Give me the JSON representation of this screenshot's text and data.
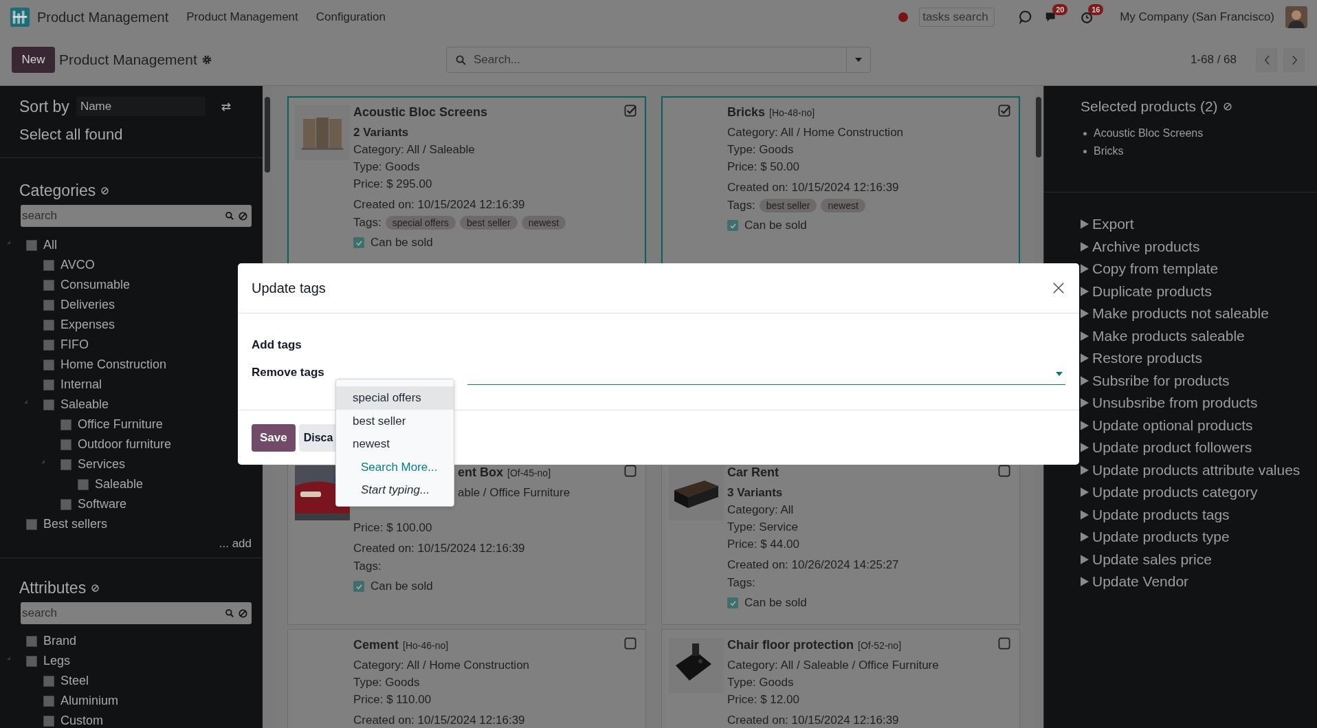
{
  "topbar": {
    "app_name": "Product Management",
    "menu": [
      "Product Management",
      "Configuration"
    ],
    "tasks_search": {
      "placeholder": "tasks search"
    },
    "messages_badge": "20",
    "activities_badge": "16",
    "company": "My Company (San Francisco)"
  },
  "control_panel": {
    "new_button": "New",
    "title": "Product Management",
    "search": {
      "placeholder": "Search..."
    },
    "pager": "1-68 / 68"
  },
  "sidebar": {
    "sort_label": "Sort by",
    "sort_value": "Name",
    "select_all": "Select all found",
    "categories": {
      "title": "Categories",
      "search_placeholder": "search",
      "add": "... add",
      "items": [
        {
          "label": "All",
          "checked": false,
          "children": [
            {
              "label": "AVCO",
              "checked": false
            },
            {
              "label": "Consumable",
              "checked": false
            },
            {
              "label": "Deliveries",
              "checked": false
            },
            {
              "label": "Expenses",
              "checked": false
            },
            {
              "label": "FIFO",
              "checked": false
            },
            {
              "label": "Home Construction",
              "checked": false
            },
            {
              "label": "Internal",
              "checked": false
            },
            {
              "label": "Saleable",
              "checked": false,
              "children": [
                {
                  "label": "Office Furniture",
                  "checked": false
                },
                {
                  "label": "Outdoor furniture",
                  "checked": false
                },
                {
                  "label": "Services",
                  "checked": false,
                  "children": [
                    {
                      "label": "Saleable",
                      "checked": false
                    }
                  ]
                },
                {
                  "label": "Software",
                  "checked": false
                }
              ]
            }
          ]
        },
        {
          "label": "Best sellers",
          "checked": false
        }
      ]
    },
    "attributes": {
      "title": "Attributes",
      "search_placeholder": "search",
      "items": [
        {
          "label": "Brand",
          "checked": false
        },
        {
          "label": "Legs",
          "checked": false,
          "children": [
            {
              "label": "Steel",
              "checked": false
            },
            {
              "label": "Aluminium",
              "checked": false
            },
            {
              "label": "Custom",
              "checked": false
            }
          ]
        }
      ]
    }
  },
  "cards": [
    {
      "name": "Acoustic Bloc Screens",
      "has_image": true,
      "variants": "2 Variants",
      "selected": true,
      "lines": [
        "Category: All / Saleable",
        "Type: Goods",
        "Price: $ 295.00"
      ],
      "created": "Created on: 10/15/2024 12:16:39",
      "tags_label": "Tags:",
      "tags": [
        "special offers",
        "best seller",
        "newest"
      ],
      "sold": {
        "label": "Can be sold",
        "checked": true
      }
    },
    {
      "name": "Bricks",
      "code": "[Ho-48-no]",
      "has_image": false,
      "selected": true,
      "lines": [
        "Category: All / Home Construction",
        "Type: Goods",
        "Price: $ 50.00"
      ],
      "created": "Created on: 10/15/2024 12:16:39",
      "tags_label": "Tags:",
      "tags": [
        "best seller",
        "newest"
      ],
      "sold": {
        "label": "Can be sold",
        "checked": true
      }
    },
    {
      "name": "ent Box",
      "code": "[Of-45-no]",
      "has_image": true,
      "covered": true,
      "selected": false,
      "covered_lines": [
        "able / Office Furniture"
      ],
      "lines": [
        "Price: $ 100.00"
      ],
      "created": "Created on: 10/15/2024 12:16:39",
      "tags_label": "Tags:",
      "sold": {
        "label": "Can be sold",
        "checked": true
      }
    },
    {
      "name": "Car Rent",
      "has_image": true,
      "variants": "3 Variants",
      "selected": false,
      "lines": [
        "Category: All",
        "Type: Service",
        "Price: $ 44.00"
      ],
      "created": "Created on: 10/26/2024 14:25:27",
      "tags_label": "Tags:",
      "sold": {
        "label": "Can be sold",
        "checked": true
      }
    },
    {
      "name": "Cement",
      "code": "[Ho-46-no]",
      "has_image": false,
      "selected": false,
      "lines": [
        "Category: All / Home Construction",
        "Type: Goods",
        "Price: $ 110.00"
      ],
      "created": "Created on: 10/15/2024 12:16:39"
    },
    {
      "name": "Chair floor protection",
      "code": "[Of-52-no]",
      "has_image": true,
      "selected": false,
      "lines": [
        "Category: All / Saleable / Office Furniture",
        "Type: Goods",
        "Price: $ 12.00"
      ],
      "created": "Created on: 10/15/2024 12:16:39"
    }
  ],
  "right_panel": {
    "title": "Selected products (2)",
    "selected": [
      "Acoustic Bloc Screens",
      "Bricks"
    ],
    "actions": [
      "Export",
      "Archive products",
      "Copy from template",
      "Duplicate products",
      "Make products not saleable",
      "Make products saleable",
      "Restore products",
      "Subsribe for products",
      "Unsubsribe from products",
      "Update optional products",
      "Update product followers",
      "Update products attribute values",
      "Update products category",
      "Update products tags",
      "Update products type",
      "Update sales price",
      "Update Vendor"
    ]
  },
  "dialog": {
    "title": "Update tags",
    "fields": [
      "Add tags",
      "Remove tags"
    ],
    "save": "Save",
    "discard": "Disca",
    "menu": [
      {
        "label": "special offers",
        "kind": "option",
        "selected": true
      },
      {
        "label": "best seller",
        "kind": "option",
        "selected": false
      },
      {
        "label": "newest",
        "kind": "option",
        "selected": false
      },
      {
        "label": "Search More...",
        "kind": "link",
        "selected": false
      },
      {
        "label": "Start typing...",
        "kind": "hint",
        "selected": false
      }
    ]
  }
}
